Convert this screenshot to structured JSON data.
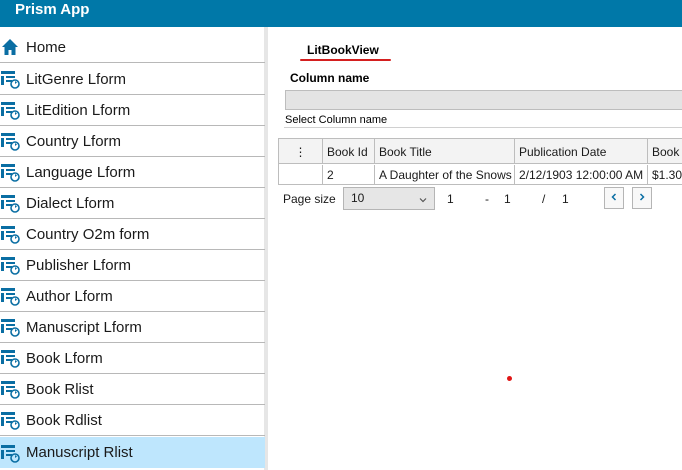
{
  "app": {
    "title": "Prism App"
  },
  "sidebar": {
    "items": [
      {
        "label": "Home",
        "icon": "home-icon"
      },
      {
        "label": "LitGenre Lform",
        "icon": "form-icon"
      },
      {
        "label": "LitEdition Lform",
        "icon": "form-icon"
      },
      {
        "label": "Country Lform",
        "icon": "form-icon"
      },
      {
        "label": "Language Lform",
        "icon": "form-icon"
      },
      {
        "label": "Dialect Lform",
        "icon": "form-icon"
      },
      {
        "label": "Country O2m form",
        "icon": "form-icon"
      },
      {
        "label": "Publisher Lform",
        "icon": "form-icon"
      },
      {
        "label": "Author Lform",
        "icon": "form-icon"
      },
      {
        "label": "Manuscript Lform",
        "icon": "form-icon"
      },
      {
        "label": "Book Lform",
        "icon": "form-icon"
      },
      {
        "label": "Book Rlist",
        "icon": "form-icon"
      },
      {
        "label": "Book Rdlist",
        "icon": "form-icon"
      },
      {
        "label": "Manuscript Rlist",
        "icon": "form-icon",
        "selected": true
      }
    ]
  },
  "main": {
    "view_title": "LitBookView",
    "column_name_label": "Column name",
    "column_name_value": "",
    "select_column_hint": "Select Column name",
    "grid": {
      "menu_glyph": "⋮",
      "columns": [
        "Book Id",
        "Book Title",
        "Publication Date",
        "Book I"
      ],
      "rows": [
        [
          "2",
          "A Daughter of the Snows",
          "2/12/1903 12:00:00 AM",
          "$1.30"
        ]
      ]
    },
    "pager": {
      "page_size_label": "Page size",
      "page_size_value": "10",
      "range_start": "1",
      "range_sep": "-",
      "range_end": "1",
      "of_sep": "/",
      "total": "1"
    }
  },
  "colors": {
    "titlebar": "#0078a8",
    "selected_item": "#bee6fd",
    "accent_icon": "#0a6ea3",
    "underline": "#d41f1f"
  }
}
